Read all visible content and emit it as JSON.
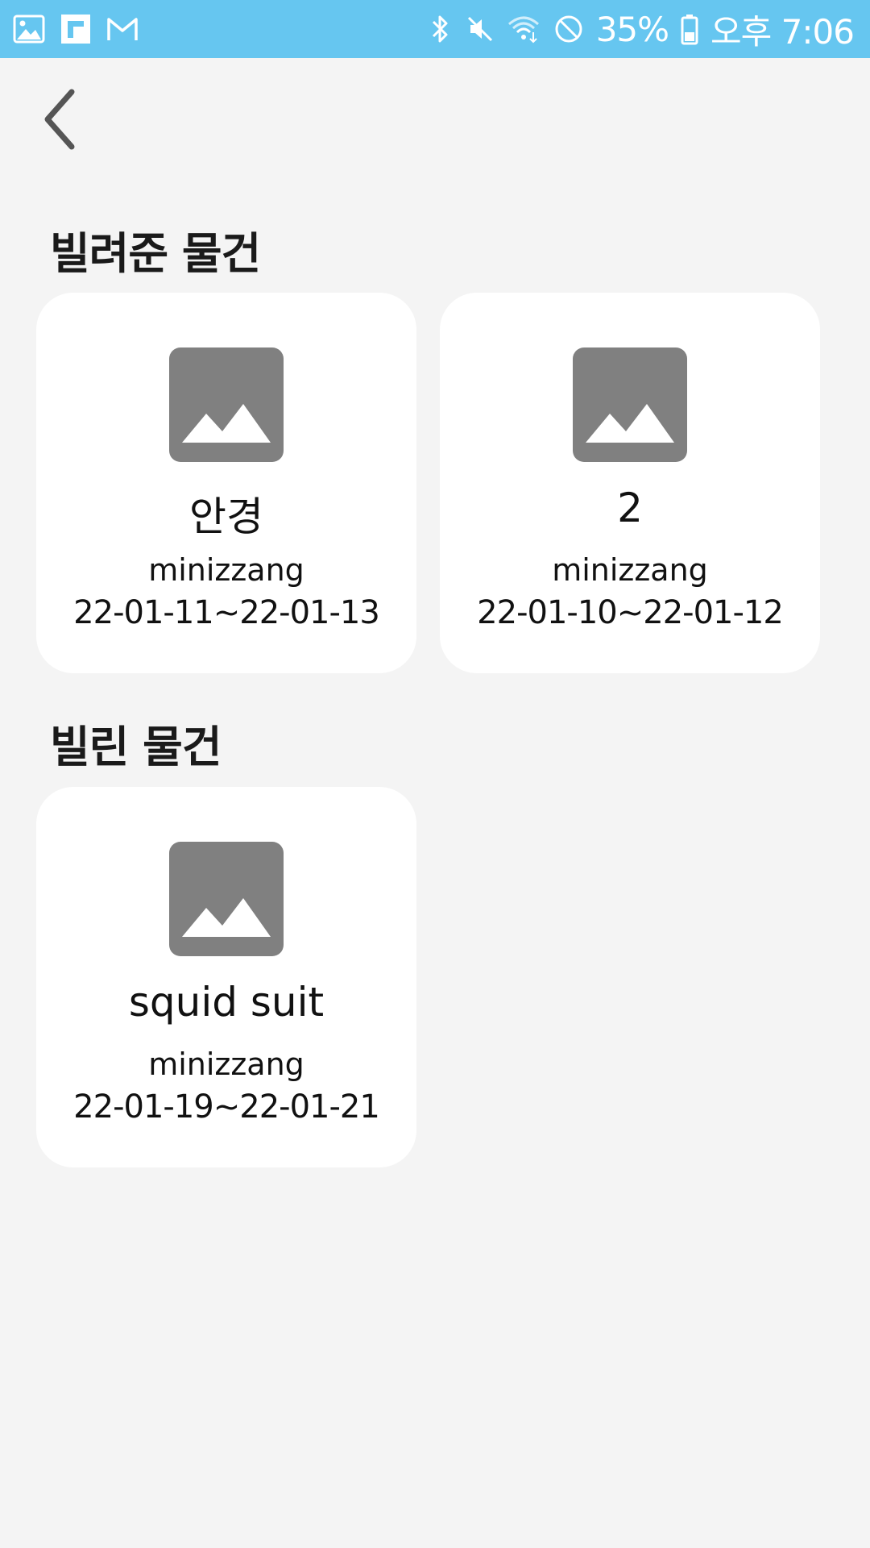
{
  "status_bar": {
    "left_icons": [
      "gallery-icon",
      "flipboard-icon",
      "gmail-icon"
    ],
    "right_icons": [
      "bluetooth-icon",
      "mute-icon",
      "wifi-icon",
      "do-not-disturb-icon",
      "battery-icon"
    ],
    "battery_percent": "35%",
    "time": "오후 7:06",
    "background_color": "#66c6f0"
  },
  "nav": {
    "back_icon": "chevron-left-icon"
  },
  "sections": {
    "lent": {
      "title": "빌려준 물건",
      "items": [
        {
          "name": "안경",
          "user": "minizzang",
          "dates": "22-01-11~22-01-13",
          "image_icon": "image-placeholder-icon"
        },
        {
          "name": "2",
          "user": "minizzang",
          "dates": "22-01-10~22-01-12",
          "image_icon": "image-placeholder-icon"
        }
      ]
    },
    "borrowed": {
      "title": "빌린 물건",
      "items": [
        {
          "name": "squid suit",
          "user": "minizzang",
          "dates": "22-01-19~22-01-21",
          "image_icon": "image-placeholder-icon"
        }
      ]
    }
  }
}
